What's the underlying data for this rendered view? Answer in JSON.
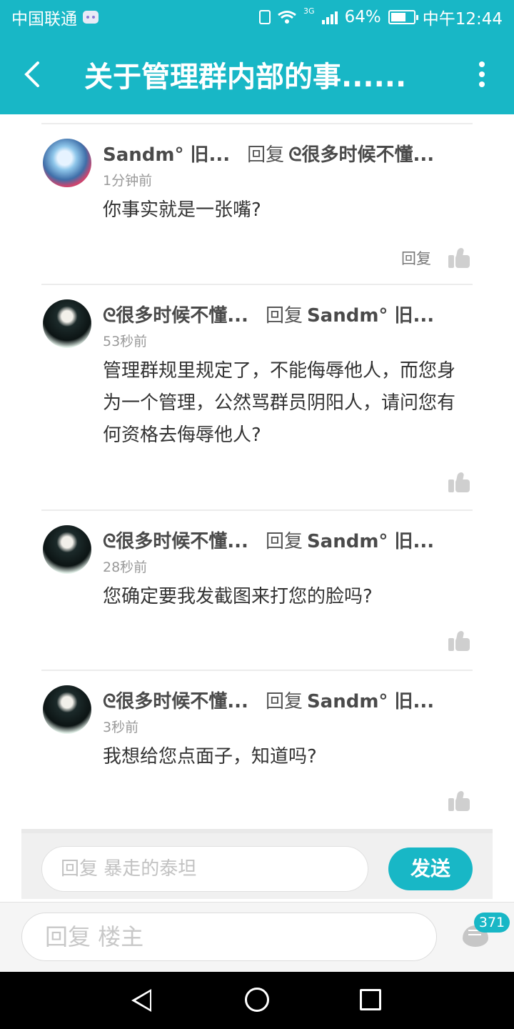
{
  "status_bar": {
    "carrier": "中国联通",
    "network_type": "3G",
    "battery_percent": "64%",
    "time": "中午12:44",
    "icons": [
      "message-badge-icon",
      "vibrate-icon",
      "wifi-icon",
      "signal-icon",
      "battery-icon"
    ]
  },
  "header": {
    "title": "关于管理群内部的事......",
    "back_icon": "chevron-left-icon",
    "more_icon": "more-vertical-icon"
  },
  "comments": [
    {
      "author": "Sandm° 旧...",
      "reply_word": "回复",
      "reply_to": "ᘓ很多时候不懂...",
      "time": "1分钟前",
      "text": "你事实就是一张嘴?",
      "reply_label": "回复"
    },
    {
      "author": "ᘓ很多时候不懂...",
      "reply_word": "回复",
      "reply_to": "Sandm° 旧...",
      "time": "53秒前",
      "text": "管理群规里规定了，不能侮辱他人，而您身为一个管理，公然骂群员阴阳人，请问您有何资格去侮辱他人?"
    },
    {
      "author": "ᘓ很多时候不懂...",
      "reply_word": "回复",
      "reply_to": "Sandm° 旧...",
      "time": "28秒前",
      "text": "您确定要我发截图来打您的脸吗?"
    },
    {
      "author": "ᘓ很多时候不懂...",
      "reply_word": "回复",
      "reply_to": "Sandm° 旧...",
      "time": "3秒前",
      "text": "我想给您点面子，知道吗?"
    }
  ],
  "reply_box": {
    "placeholder": "回复 暴走的泰坦",
    "send_label": "发送"
  },
  "bottom": {
    "placeholder": "回复  楼主",
    "comment_count": "371"
  },
  "colors": {
    "accent": "#18b7c6",
    "background": "#ffffff",
    "secondary_text": "#999999"
  }
}
